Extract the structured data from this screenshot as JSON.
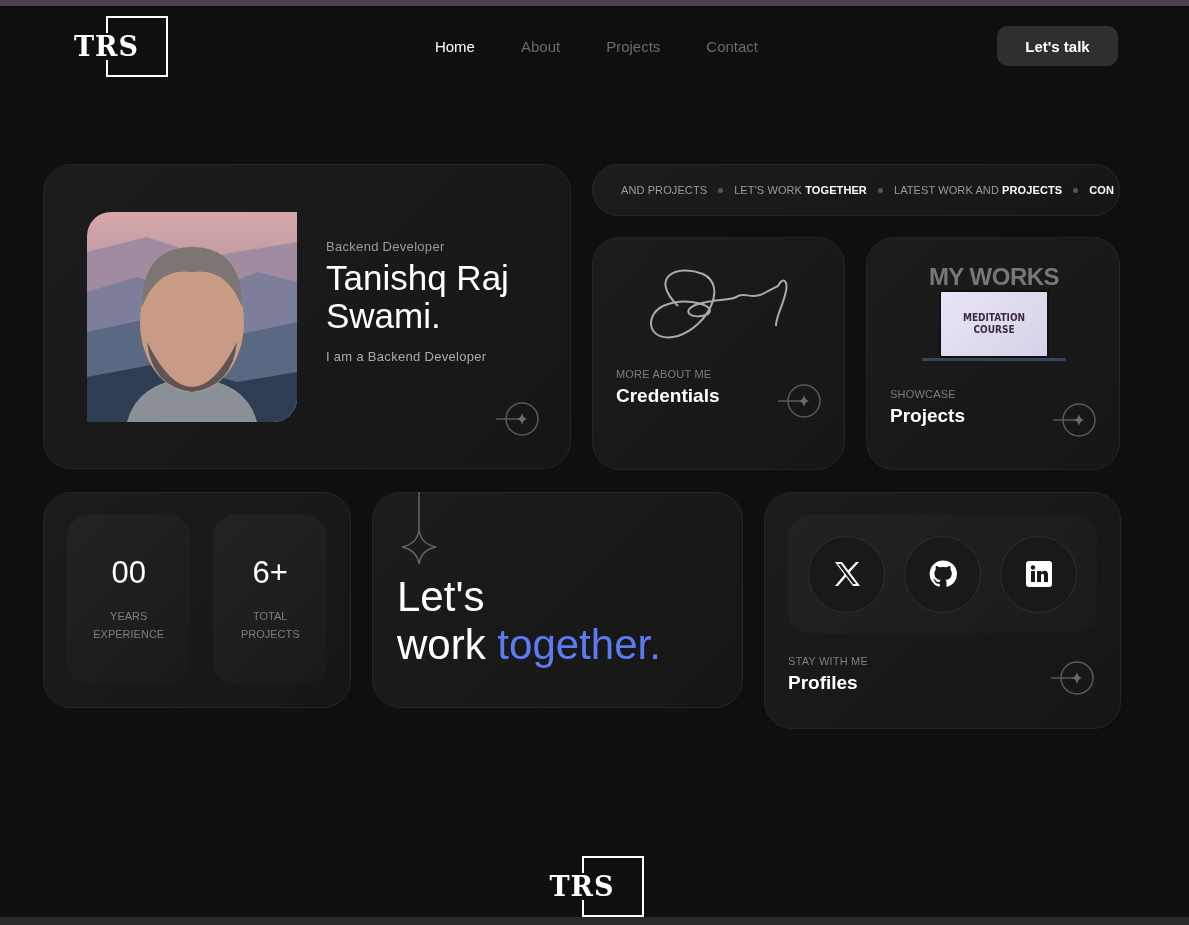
{
  "header": {
    "logo": "TRS",
    "nav": [
      {
        "label": "Home",
        "selected": true
      },
      {
        "label": "About",
        "selected": false
      },
      {
        "label": "Projects",
        "selected": false
      },
      {
        "label": "Contact",
        "selected": false
      }
    ],
    "cta": "Let's talk"
  },
  "profile_card": {
    "role": "Backend Developer",
    "name": "Tanishq Raj Swami.",
    "bio": "I am a Backend Developer"
  },
  "marquee": [
    "AND PROJECTS",
    "LET'S WORK **TOGETHER**",
    "LATEST WORK AND **PROJECTS**",
    "**CON**"
  ],
  "credentials_card": {
    "eyebrow": "MORE ABOUT ME",
    "title": "Credentials"
  },
  "projects_card": {
    "banner": "MY WORKS",
    "screen_title": "MEDITATION COURSE",
    "eyebrow": "SHOWCASE",
    "title": "Projects"
  },
  "stats": [
    {
      "value": "00",
      "label": "YEARS EXPERIENCE"
    },
    {
      "value": "6+",
      "label": "TOTAL PROJECTS"
    }
  ],
  "cta_card": {
    "line_1": "Let's",
    "line_2": "work",
    "accent": "together."
  },
  "profiles_card": {
    "socials": [
      {
        "kind": "x"
      },
      {
        "kind": "github"
      },
      {
        "kind": "linkedin"
      }
    ],
    "eyebrow": "STAY WITH ME",
    "title": "Profiles"
  },
  "footer": {
    "logo": "TRS"
  }
}
